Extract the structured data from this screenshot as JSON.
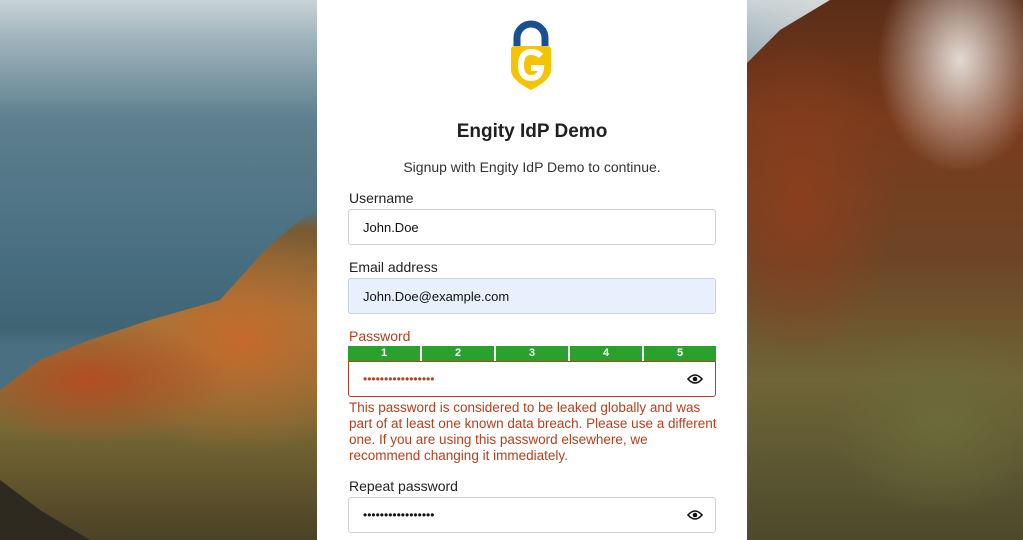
{
  "app": {
    "title": "Engity IdP Demo",
    "subtitle": "Signup with Engity IdP Demo to continue.",
    "logo_icon": "engity-shield-logo"
  },
  "colors": {
    "accent_blue": "#1b4f93",
    "accent_yellow": "#f4c400",
    "error": "#b3401e",
    "strength_green": "#2aa12d"
  },
  "form": {
    "username": {
      "label": "Username",
      "value": "John.Doe"
    },
    "email": {
      "label": "Email address",
      "value": "John.Doe@example.com"
    },
    "password": {
      "label": "Password",
      "masked_value": "•••••••••••••••••",
      "strength_segments": [
        "1",
        "2",
        "3",
        "4",
        "5"
      ],
      "strength_level": 5,
      "error": "This password is considered to be leaked globally and was part of at least one known data breach. Please use a different one. If you are using this password elsewhere, we recommend changing it immediately.",
      "toggle_icon": "eye-icon"
    },
    "repeat_password": {
      "label": "Repeat password",
      "masked_value": "•••••••••••••••••",
      "toggle_icon": "eye-icon"
    }
  }
}
